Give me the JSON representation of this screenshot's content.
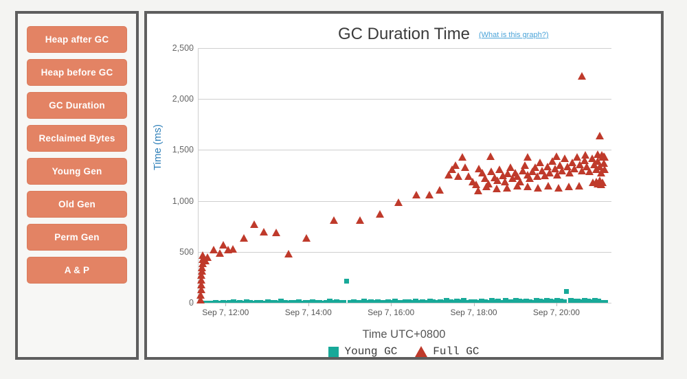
{
  "sidebar": {
    "items": [
      {
        "label": "Heap after GC"
      },
      {
        "label": "Heap before GC"
      },
      {
        "label": "GC Duration"
      },
      {
        "label": "Reclaimed Bytes"
      },
      {
        "label": "Young Gen"
      },
      {
        "label": "Old Gen"
      },
      {
        "label": "Perm Gen"
      },
      {
        "label": "A & P"
      }
    ]
  },
  "chart_panel": {
    "title": "GC Duration Time",
    "help_link": "(What is this graph?)"
  },
  "colors": {
    "button_fill": "#e38364",
    "panel_border": "#5e5e5e",
    "page_background": "#f4f4f2",
    "young_gc": "#18a999",
    "full_gc": "#bf3a2b",
    "link": "#4aa3d8",
    "yaxis_title": "#2e7fb8",
    "gridline": "#cfcfcf"
  },
  "chart_data": {
    "type": "scatter",
    "title": "GC Duration Time",
    "xlabel": "Time UTC+0800",
    "ylabel": "Time (ms)",
    "ylim": [
      0,
      2500
    ],
    "yticks": [
      0,
      500,
      1000,
      1500,
      2000,
      2500
    ],
    "ytick_labels": [
      "0",
      "500",
      "1,000",
      "1,500",
      "2,000",
      "2,500"
    ],
    "xlim": [
      "Sep 7, 11:20",
      "Sep 7, 21:20"
    ],
    "xticks": [
      "Sep 7, 12:00",
      "Sep 7, 14:00",
      "Sep 7, 16:00",
      "Sep 7, 18:00",
      "Sep 7, 20:00"
    ],
    "xtick_positions_hours": [
      12.0,
      14.0,
      16.0,
      18.0,
      20.0
    ],
    "grid": "horizontal",
    "legend_position": "bottom-center",
    "series": [
      {
        "name": "Young GC",
        "marker": "square",
        "color": "#18a999",
        "points": [
          [
            11.42,
            14
          ],
          [
            11.5,
            18
          ],
          [
            11.58,
            22
          ],
          [
            11.67,
            16
          ],
          [
            11.75,
            30
          ],
          [
            11.83,
            20
          ],
          [
            11.92,
            26
          ],
          [
            12.0,
            18
          ],
          [
            12.08,
            24
          ],
          [
            12.17,
            34
          ],
          [
            12.25,
            20
          ],
          [
            12.33,
            28
          ],
          [
            12.42,
            22
          ],
          [
            12.5,
            36
          ],
          [
            12.58,
            24
          ],
          [
            12.67,
            18
          ],
          [
            12.75,
            30
          ],
          [
            12.83,
            26
          ],
          [
            12.92,
            20
          ],
          [
            13.0,
            32
          ],
          [
            13.08,
            24
          ],
          [
            13.17,
            28
          ],
          [
            13.25,
            22
          ],
          [
            13.33,
            38
          ],
          [
            13.42,
            26
          ],
          [
            13.5,
            20
          ],
          [
            13.58,
            30
          ],
          [
            13.67,
            24
          ],
          [
            13.75,
            34
          ],
          [
            13.83,
            22
          ],
          [
            13.92,
            28
          ],
          [
            14.0,
            26
          ],
          [
            14.08,
            36
          ],
          [
            14.17,
            24
          ],
          [
            14.25,
            30
          ],
          [
            14.33,
            22
          ],
          [
            14.42,
            28
          ],
          [
            14.5,
            40
          ],
          [
            14.58,
            26
          ],
          [
            14.67,
            32
          ],
          [
            14.75,
            24
          ],
          [
            14.83,
            30
          ],
          [
            14.92,
            215
          ],
          [
            15.0,
            28
          ],
          [
            15.08,
            34
          ],
          [
            15.17,
            26
          ],
          [
            15.25,
            30
          ],
          [
            15.33,
            38
          ],
          [
            15.42,
            24
          ],
          [
            15.5,
            32
          ],
          [
            15.58,
            28
          ],
          [
            15.67,
            36
          ],
          [
            15.75,
            26
          ],
          [
            15.83,
            30
          ],
          [
            15.92,
            34
          ],
          [
            16.0,
            28
          ],
          [
            16.08,
            42
          ],
          [
            16.17,
            30
          ],
          [
            16.25,
            26
          ],
          [
            16.33,
            36
          ],
          [
            16.42,
            32
          ],
          [
            16.5,
            28
          ],
          [
            16.58,
            38
          ],
          [
            16.67,
            30
          ],
          [
            16.75,
            34
          ],
          [
            16.83,
            26
          ],
          [
            16.92,
            40
          ],
          [
            17.0,
            32
          ],
          [
            17.08,
            28
          ],
          [
            17.17,
            36
          ],
          [
            17.25,
            30
          ],
          [
            17.33,
            44
          ],
          [
            17.42,
            34
          ],
          [
            17.5,
            28
          ],
          [
            17.58,
            38
          ],
          [
            17.67,
            32
          ],
          [
            17.75,
            48
          ],
          [
            17.83,
            30
          ],
          [
            17.92,
            36
          ],
          [
            18.0,
            34
          ],
          [
            18.08,
            28
          ],
          [
            18.17,
            42
          ],
          [
            18.25,
            36
          ],
          [
            18.33,
            30
          ],
          [
            18.42,
            46
          ],
          [
            18.5,
            34
          ],
          [
            18.58,
            38
          ],
          [
            18.67,
            30
          ],
          [
            18.75,
            44
          ],
          [
            18.83,
            36
          ],
          [
            18.92,
            32
          ],
          [
            19.0,
            48
          ],
          [
            19.08,
            38
          ],
          [
            19.17,
            34
          ],
          [
            19.25,
            42
          ],
          [
            19.33,
            36
          ],
          [
            19.42,
            30
          ],
          [
            19.5,
            46
          ],
          [
            19.58,
            40
          ],
          [
            19.67,
            34
          ],
          [
            19.75,
            50
          ],
          [
            19.83,
            38
          ],
          [
            19.92,
            36
          ],
          [
            20.0,
            44
          ],
          [
            20.08,
            40
          ],
          [
            20.17,
            34
          ],
          [
            20.25,
            110
          ],
          [
            20.33,
            46
          ],
          [
            20.42,
            38
          ],
          [
            20.5,
            42
          ],
          [
            20.58,
            36
          ],
          [
            20.67,
            48
          ],
          [
            20.75,
            40
          ],
          [
            20.83,
            34
          ],
          [
            20.92,
            44
          ],
          [
            21.0,
            38
          ],
          [
            21.08,
            30
          ],
          [
            21.17,
            24
          ]
        ]
      },
      {
        "name": "Full GC",
        "marker": "triangle",
        "color": "#bf3a2b",
        "points": [
          [
            11.4,
            30
          ],
          [
            11.4,
            80
          ],
          [
            11.41,
            130
          ],
          [
            11.41,
            180
          ],
          [
            11.42,
            225
          ],
          [
            11.42,
            270
          ],
          [
            11.43,
            310
          ],
          [
            11.43,
            350
          ],
          [
            11.44,
            390
          ],
          [
            11.44,
            430
          ],
          [
            11.45,
            470
          ],
          [
            11.52,
            415
          ],
          [
            11.57,
            445
          ],
          [
            11.72,
            520
          ],
          [
            11.86,
            490
          ],
          [
            11.95,
            570
          ],
          [
            12.06,
            520
          ],
          [
            12.18,
            530
          ],
          [
            12.44,
            640
          ],
          [
            12.7,
            770
          ],
          [
            12.92,
            700
          ],
          [
            13.22,
            690
          ],
          [
            13.52,
            480
          ],
          [
            13.95,
            640
          ],
          [
            14.62,
            810
          ],
          [
            15.25,
            810
          ],
          [
            15.73,
            870
          ],
          [
            16.18,
            990
          ],
          [
            16.62,
            1060
          ],
          [
            16.93,
            1060
          ],
          [
            17.18,
            1110
          ],
          [
            17.4,
            1260
          ],
          [
            17.48,
            1310
          ],
          [
            17.56,
            1350
          ],
          [
            17.63,
            1240
          ],
          [
            17.72,
            1430
          ],
          [
            17.8,
            1330
          ],
          [
            17.88,
            1240
          ],
          [
            17.97,
            1190
          ],
          [
            18.05,
            1160
          ],
          [
            18.12,
            1320
          ],
          [
            18.2,
            1280
          ],
          [
            18.28,
            1220
          ],
          [
            18.35,
            1170
          ],
          [
            18.42,
            1290
          ],
          [
            18.5,
            1230
          ],
          [
            18.57,
            1200
          ],
          [
            18.63,
            1310
          ],
          [
            18.7,
            1250
          ],
          [
            18.76,
            1190
          ],
          [
            18.82,
            1270
          ],
          [
            18.88,
            1330
          ],
          [
            18.94,
            1220
          ],
          [
            19.0,
            1280
          ],
          [
            19.06,
            1240
          ],
          [
            19.12,
            1190
          ],
          [
            19.18,
            1300
          ],
          [
            19.24,
            1350
          ],
          [
            19.3,
            1260
          ],
          [
            19.36,
            1220
          ],
          [
            19.42,
            1290
          ],
          [
            19.48,
            1330
          ],
          [
            19.54,
            1240
          ],
          [
            19.6,
            1380
          ],
          [
            19.66,
            1300
          ],
          [
            19.72,
            1250
          ],
          [
            19.78,
            1340
          ],
          [
            19.84,
            1280
          ],
          [
            19.9,
            1390
          ],
          [
            19.96,
            1320
          ],
          [
            20.02,
            1260
          ],
          [
            20.08,
            1350
          ],
          [
            20.14,
            1300
          ],
          [
            20.2,
            1420
          ],
          [
            20.26,
            1340
          ],
          [
            20.32,
            1280
          ],
          [
            20.38,
            1380
          ],
          [
            20.44,
            1320
          ],
          [
            20.5,
            1430
          ],
          [
            20.56,
            1360
          ],
          [
            20.62,
            1300
          ],
          [
            20.68,
            1400
          ],
          [
            20.74,
            1340
          ],
          [
            20.8,
            1290
          ],
          [
            20.86,
            1420
          ],
          [
            20.92,
            1360
          ],
          [
            20.96,
            1310
          ],
          [
            21.0,
            1390
          ],
          [
            21.04,
            1340
          ],
          [
            21.08,
            1280
          ],
          [
            21.12,
            1430
          ],
          [
            21.14,
            1370
          ],
          [
            21.16,
            1310
          ],
          [
            20.62,
            2230
          ],
          [
            21.04,
            1640
          ],
          [
            18.4,
            1440
          ],
          [
            19.3,
            1430
          ],
          [
            20.0,
            1440
          ],
          [
            20.7,
            1450
          ],
          [
            21.0,
            1460
          ],
          [
            21.1,
            1450
          ],
          [
            21.14,
            1440
          ],
          [
            21.16,
            1430
          ],
          [
            20.88,
            1180
          ],
          [
            20.55,
            1150
          ],
          [
            20.3,
            1140
          ],
          [
            20.05,
            1130
          ],
          [
            19.8,
            1150
          ],
          [
            19.55,
            1130
          ],
          [
            19.3,
            1140
          ],
          [
            19.05,
            1150
          ],
          [
            18.8,
            1130
          ],
          [
            18.55,
            1120
          ],
          [
            18.3,
            1140
          ],
          [
            18.1,
            1100
          ],
          [
            21.12,
            1180
          ],
          [
            21.08,
            1160
          ],
          [
            21.04,
            1200
          ],
          [
            21.0,
            1170
          ],
          [
            20.96,
            1190
          ]
        ]
      }
    ]
  }
}
